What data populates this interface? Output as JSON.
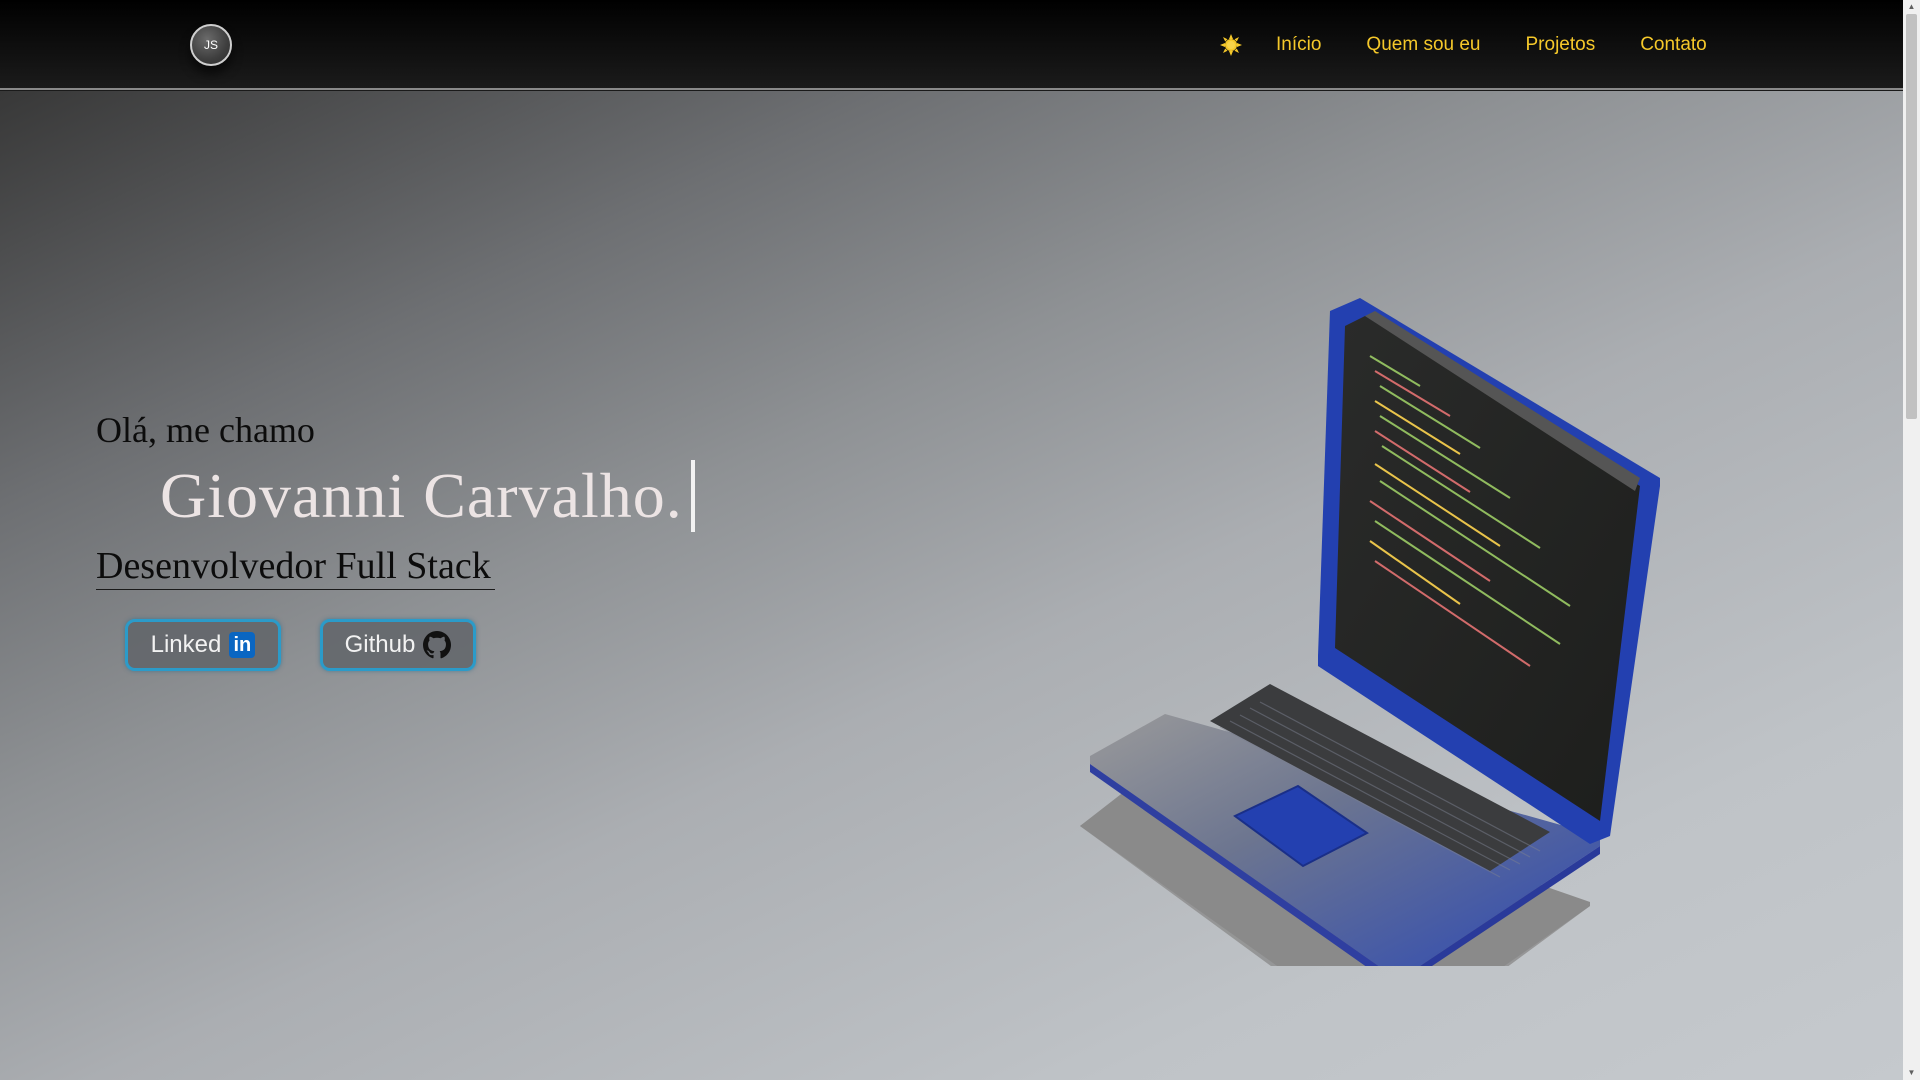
{
  "header": {
    "logo_text": "JS",
    "theme_toggle_icon": "sun-icon",
    "nav": [
      {
        "label": "Início"
      },
      {
        "label": "Quem sou eu"
      },
      {
        "label": "Projetos"
      },
      {
        "label": "Contato"
      }
    ]
  },
  "hero": {
    "greeting": "Olá, me chamo",
    "name": "Giovanni Carvalho.",
    "role": "Desenvolvedor Full Stack",
    "buttons": {
      "linkedin_label": "Linked",
      "linkedin_icon_text": "in",
      "github_label": "Github"
    },
    "illustration": "laptop-with-code-illustration"
  },
  "colors": {
    "nav_text": "#f5c82a",
    "button_border": "#2b9bc9",
    "name_text": "#ece4e4",
    "laptop_blue": "#2340b0"
  }
}
